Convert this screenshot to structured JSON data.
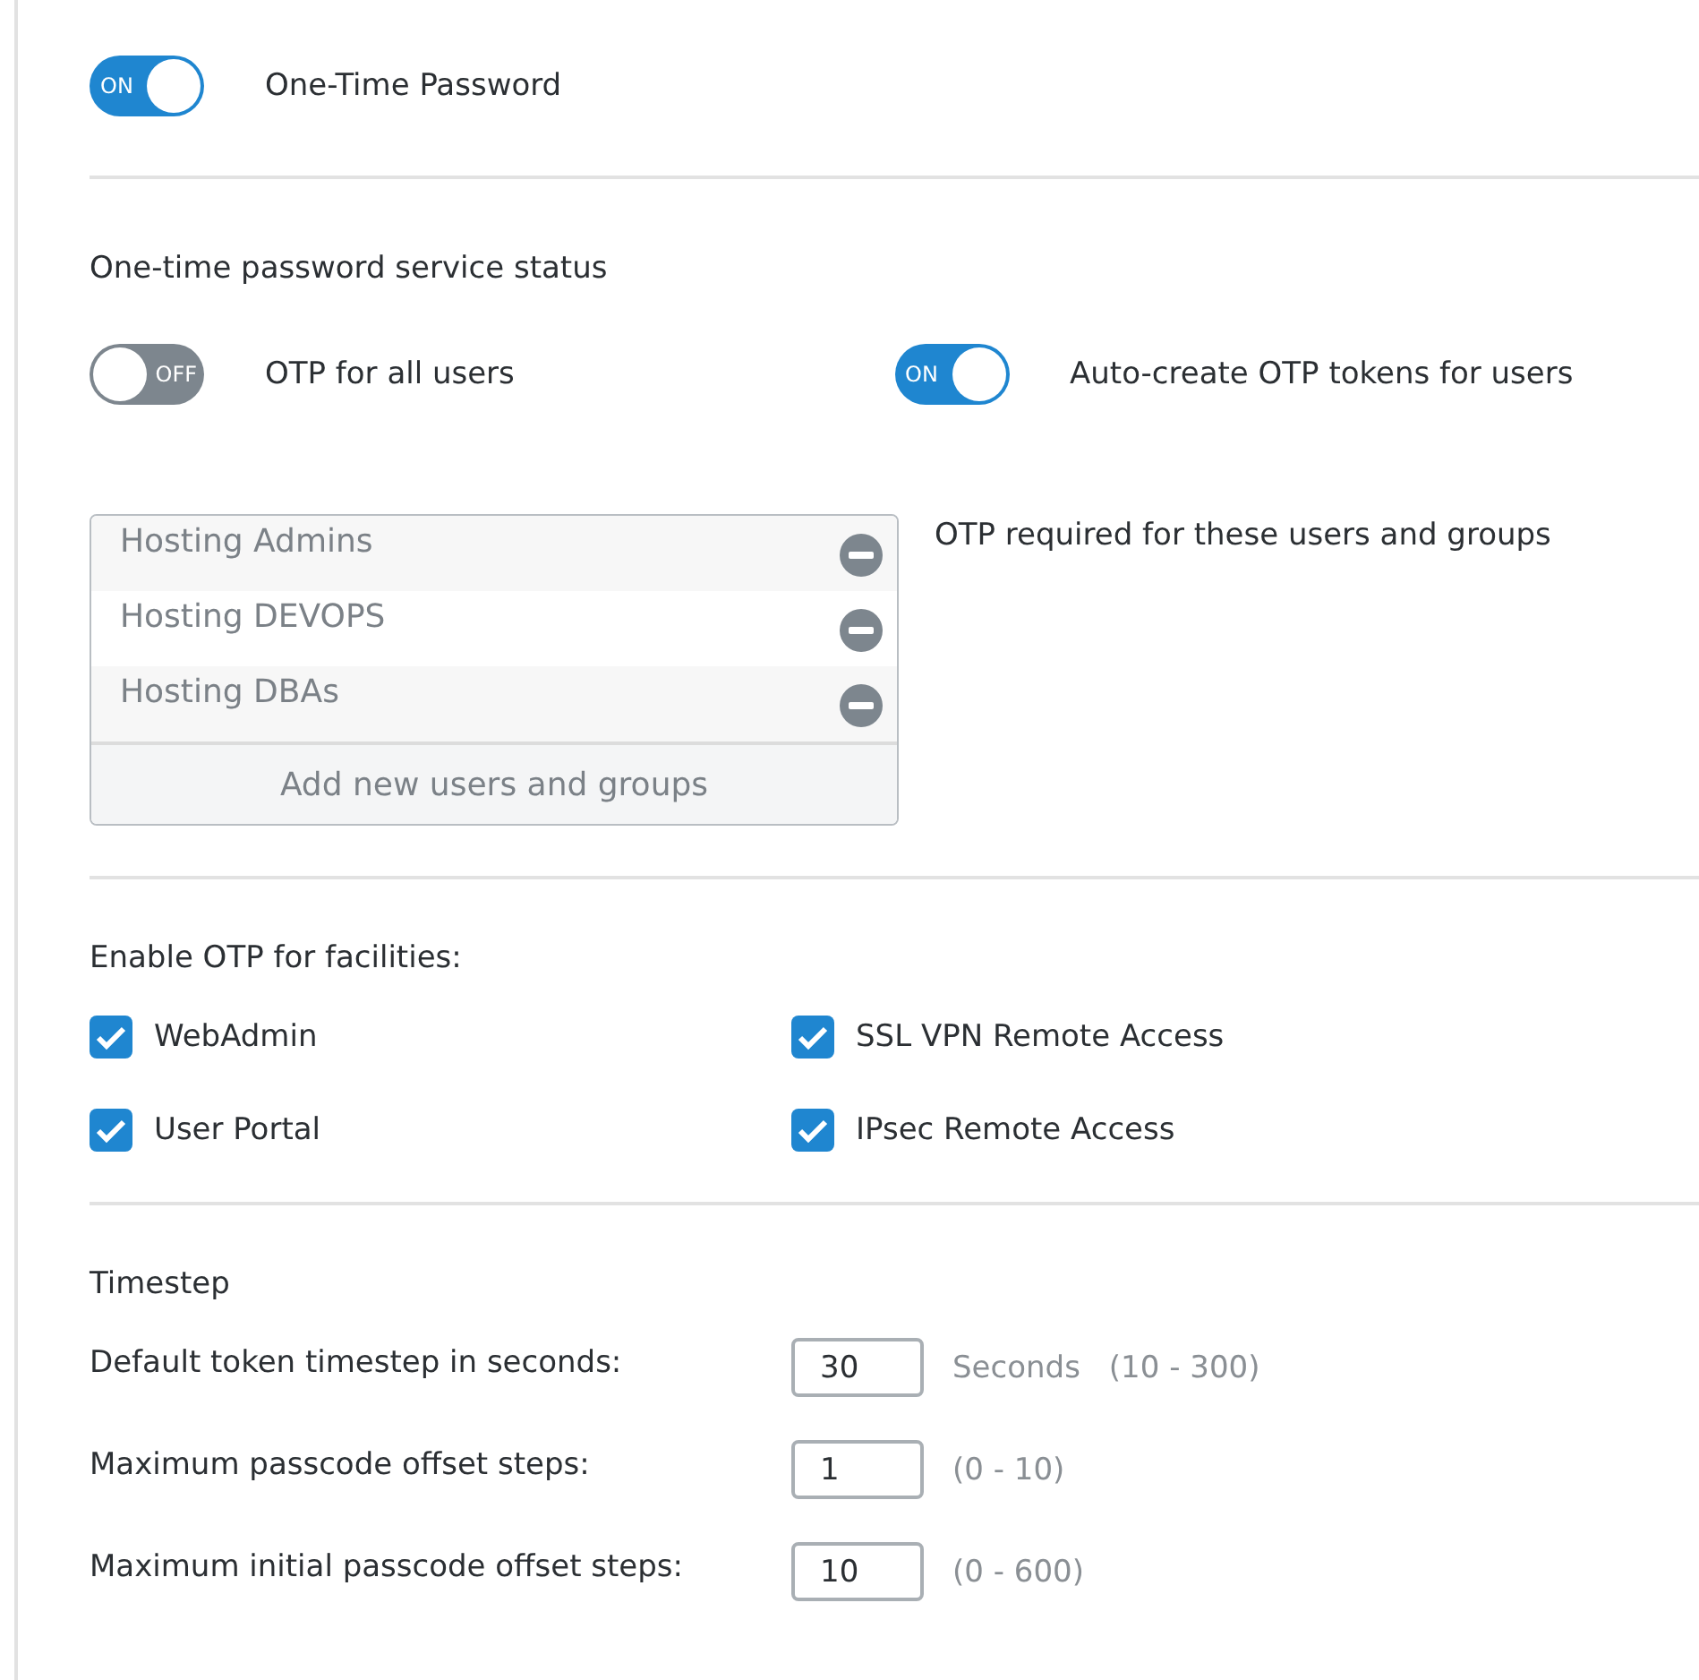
{
  "main_toggle": {
    "label": "One-Time Password",
    "on": true,
    "switch_text": "ON"
  },
  "service": {
    "title": "One-time password service status",
    "toggles": [
      {
        "label": "OTP for all users",
        "on": false,
        "switch_text": "OFF"
      },
      {
        "label": "Auto-create OTP tokens for users",
        "on": true,
        "switch_text": "ON"
      }
    ]
  },
  "users_list": {
    "items": [
      "Hosting Admins",
      "Hosting DEVOPS",
      "Hosting DBAs"
    ],
    "add_button": "Add new users and groups",
    "caption": "OTP required for these users and groups"
  },
  "facilities": {
    "title": "Enable OTP for facilities:",
    "items": [
      {
        "label": "WebAdmin",
        "checked": true
      },
      {
        "label": "SSL VPN Remote Access",
        "checked": true
      },
      {
        "label": "User Portal",
        "checked": true
      },
      {
        "label": "IPsec Remote Access",
        "checked": true
      }
    ]
  },
  "timestep": {
    "title": "Timestep",
    "rows": [
      {
        "label": "Default token timestep in seconds:",
        "value": "30",
        "unit": "Seconds",
        "range": "(10 - 300)"
      },
      {
        "label": "Maximum passcode offset steps:",
        "value": "1",
        "range": "(0 - 10)"
      },
      {
        "label": "Maximum initial passcode offset steps:",
        "value": "10",
        "range": "(0 - 600)"
      }
    ]
  }
}
